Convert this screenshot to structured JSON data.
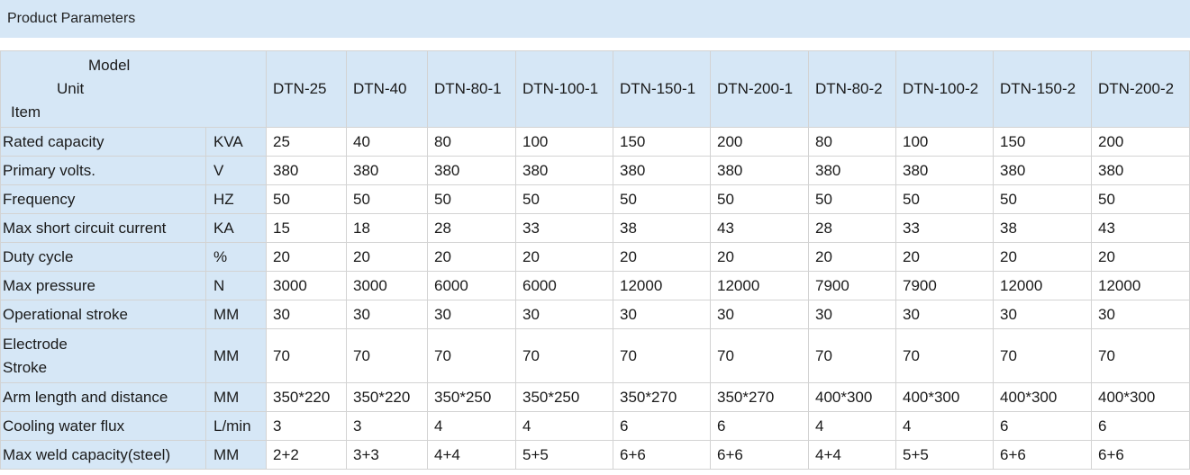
{
  "section": {
    "title": "Product Parameters"
  },
  "table": {
    "corner": {
      "model": "Model",
      "unit": "Unit",
      "item": "Item"
    },
    "models": [
      "DTN-25",
      "DTN-40",
      "DTN-80-1",
      "DTN-100-1",
      "DTN-150-1",
      "DTN-200-1",
      "DTN-80-2",
      "DTN-100-2",
      "DTN-150-2",
      "DTN-200-2"
    ],
    "rows": [
      {
        "item": "Rated capacity",
        "unit": "KVA",
        "values": [
          "25",
          "40",
          "80",
          "100",
          "150",
          "200",
          "80",
          "100",
          "150",
          "200"
        ]
      },
      {
        "item": "Primary volts.",
        "unit": "V",
        "values": [
          "380",
          "380",
          "380",
          "380",
          "380",
          "380",
          "380",
          "380",
          "380",
          "380"
        ]
      },
      {
        "item": "Frequency",
        "unit": "HZ",
        "values": [
          "50",
          "50",
          "50",
          "50",
          "50",
          "50",
          "50",
          "50",
          "50",
          "50"
        ]
      },
      {
        "item": "Max short circuit current",
        "unit": "KA",
        "values": [
          "15",
          "18",
          "28",
          "33",
          "38",
          "43",
          "28",
          "33",
          "38",
          "43"
        ]
      },
      {
        "item": "Duty cycle",
        "unit": "%",
        "values": [
          "20",
          "20",
          "20",
          "20",
          "20",
          "20",
          "20",
          "20",
          "20",
          "20"
        ]
      },
      {
        "item": "Max pressure",
        "unit": "N",
        "values": [
          "3000",
          "3000",
          "6000",
          "6000",
          "12000",
          "12000",
          "7900",
          "7900",
          "12000",
          "12000"
        ]
      },
      {
        "item": "Operational stroke",
        "unit": "MM",
        "values": [
          "30",
          "30",
          "30",
          "30",
          "30",
          "30",
          "30",
          "30",
          "30",
          "30"
        ]
      },
      {
        "item": "Electrode Stroke",
        "unit": "MM",
        "values": [
          "70",
          "70",
          "70",
          "70",
          "70",
          "70",
          "70",
          "70",
          "70",
          "70"
        ]
      },
      {
        "item": "Arm length and distance",
        "unit": "MM",
        "values": [
          "350*220",
          "350*220",
          "350*250",
          "350*250",
          "350*270",
          "350*270",
          "400*300",
          "400*300",
          "400*300",
          "400*300"
        ]
      },
      {
        "item": "Cooling water flux",
        "unit": "L/min",
        "values": [
          "3",
          "3",
          "4",
          "4",
          "6",
          "6",
          "4",
          "4",
          "6",
          "6"
        ]
      },
      {
        "item": "Max weld capacity(steel)",
        "unit": "MM",
        "values": [
          "2+2",
          "3+3",
          "4+4",
          "5+5",
          "6+6",
          "6+6",
          "4+4",
          "5+5",
          "6+6",
          "6+6"
        ]
      }
    ]
  }
}
